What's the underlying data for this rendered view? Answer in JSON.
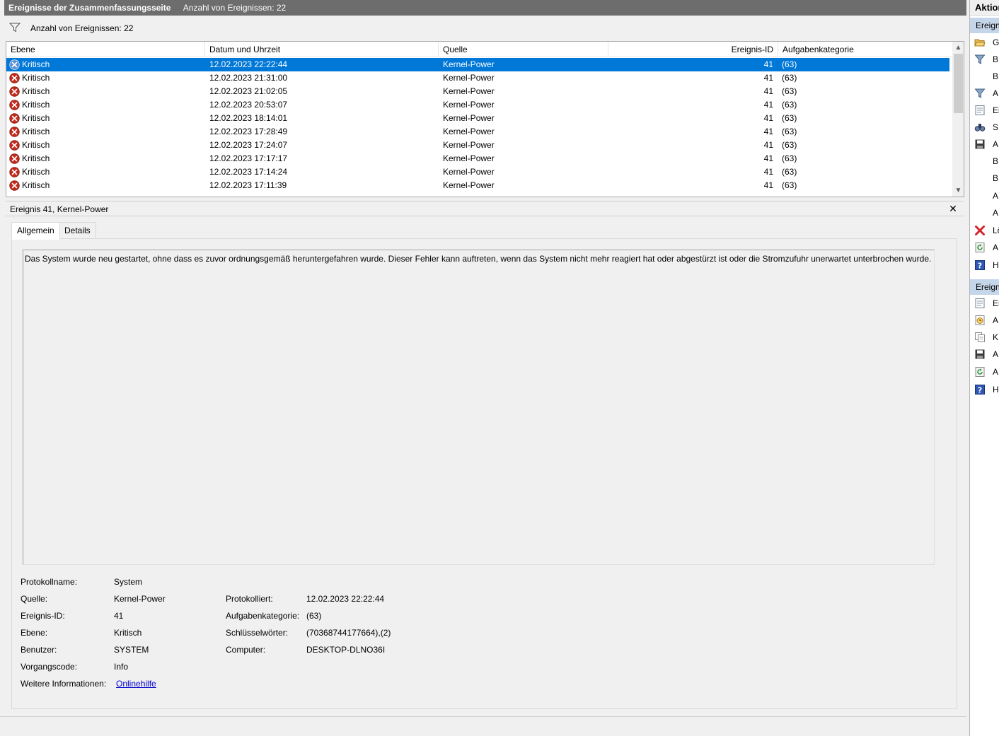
{
  "title": {
    "main": "Ereignisse der Zusammenfassungsseite",
    "count": "Anzahl von Ereignissen: 22"
  },
  "filter_text": "Anzahl von Ereignissen: 22",
  "columns": [
    "Ebene",
    "Datum und Uhrzeit",
    "Quelle",
    "Ereignis-ID",
    "Aufgabenkategorie"
  ],
  "events": [
    {
      "level": "Kritisch",
      "date": "12.02.2023 22:22:44",
      "source": "Kernel-Power",
      "id": "41",
      "category": "(63)"
    },
    {
      "level": "Kritisch",
      "date": "12.02.2023 21:31:00",
      "source": "Kernel-Power",
      "id": "41",
      "category": "(63)"
    },
    {
      "level": "Kritisch",
      "date": "12.02.2023 21:02:05",
      "source": "Kernel-Power",
      "id": "41",
      "category": "(63)"
    },
    {
      "level": "Kritisch",
      "date": "12.02.2023 20:53:07",
      "source": "Kernel-Power",
      "id": "41",
      "category": "(63)"
    },
    {
      "level": "Kritisch",
      "date": "12.02.2023 18:14:01",
      "source": "Kernel-Power",
      "id": "41",
      "category": "(63)"
    },
    {
      "level": "Kritisch",
      "date": "12.02.2023 17:28:49",
      "source": "Kernel-Power",
      "id": "41",
      "category": "(63)"
    },
    {
      "level": "Kritisch",
      "date": "12.02.2023 17:24:07",
      "source": "Kernel-Power",
      "id": "41",
      "category": "(63)"
    },
    {
      "level": "Kritisch",
      "date": "12.02.2023 17:17:17",
      "source": "Kernel-Power",
      "id": "41",
      "category": "(63)"
    },
    {
      "level": "Kritisch",
      "date": "12.02.2023 17:14:24",
      "source": "Kernel-Power",
      "id": "41",
      "category": "(63)"
    },
    {
      "level": "Kritisch",
      "date": "12.02.2023 17:11:39",
      "source": "Kernel-Power",
      "id": "41",
      "category": "(63)"
    }
  ],
  "detail": {
    "title": "Ereignis 41, Kernel-Power",
    "tabs": [
      "Allgemein",
      "Details"
    ],
    "description": "Das System wurde neu gestartet, ohne dass es zuvor ordnungsgemäß heruntergefahren wurde. Dieser Fehler kann auftreten, wenn das System nicht mehr reagiert hat oder abgestürzt ist oder die Stromzufuhr unerwartet unterbrochen wurde.",
    "labels": {
      "log_name": "Protokollname:",
      "source": "Quelle:",
      "event_id": "Ereignis-ID:",
      "level": "Ebene:",
      "user": "Benutzer:",
      "opcode": "Vorgangscode:",
      "more_info": "Weitere Informationen:",
      "logged": "Protokolliert:",
      "task_category": "Aufgabenkategorie:",
      "keywords": "Schlüsselwörter:",
      "computer": "Computer:"
    },
    "values": {
      "log_name": "System",
      "source": "Kernel-Power",
      "event_id": "41",
      "level": "Kritisch",
      "user": "SYSTEM",
      "opcode": "Info",
      "more_info": "Onlinehilfe",
      "logged": "12.02.2023 22:22:44",
      "task_category": "(63)",
      "keywords": "(70368744177664),(2)",
      "computer": "DESKTOP-DLNO36I"
    }
  },
  "actions": {
    "title": "Aktion",
    "section1": "Ereign",
    "section1_items": [
      {
        "label": "G",
        "icon": "open-folder-icon"
      },
      {
        "label": "B",
        "icon": "filter-icon"
      },
      {
        "label": "B",
        "icon": ""
      },
      {
        "label": "A",
        "icon": "filter-icon"
      },
      {
        "label": "Ei",
        "icon": "properties-icon"
      },
      {
        "label": "Sı",
        "icon": "find-icon"
      },
      {
        "label": "A",
        "icon": "save-icon"
      },
      {
        "label": "B",
        "icon": ""
      },
      {
        "label": "B",
        "icon": ""
      },
      {
        "label": "A",
        "icon": ""
      },
      {
        "label": "A",
        "icon": ""
      },
      {
        "label": "Lö",
        "icon": "delete-icon"
      },
      {
        "label": "A",
        "icon": "refresh-icon"
      },
      {
        "label": "H",
        "icon": "help-icon"
      }
    ],
    "section2": "Ereign",
    "section2_items": [
      {
        "label": "Er",
        "icon": "properties-icon"
      },
      {
        "label": "A",
        "icon": "attach-task-icon"
      },
      {
        "label": "Kı",
        "icon": "copy-icon"
      },
      {
        "label": "A",
        "icon": "save-icon"
      },
      {
        "label": "A",
        "icon": "refresh-icon"
      },
      {
        "label": "H",
        "icon": "help-icon"
      }
    ]
  },
  "colors": {
    "selection": "#0078d7",
    "titlebar": "#6d6d6d",
    "action_section": "#c5d6ea",
    "critical_icon": "#c42b1c",
    "link": "#0000cc"
  }
}
